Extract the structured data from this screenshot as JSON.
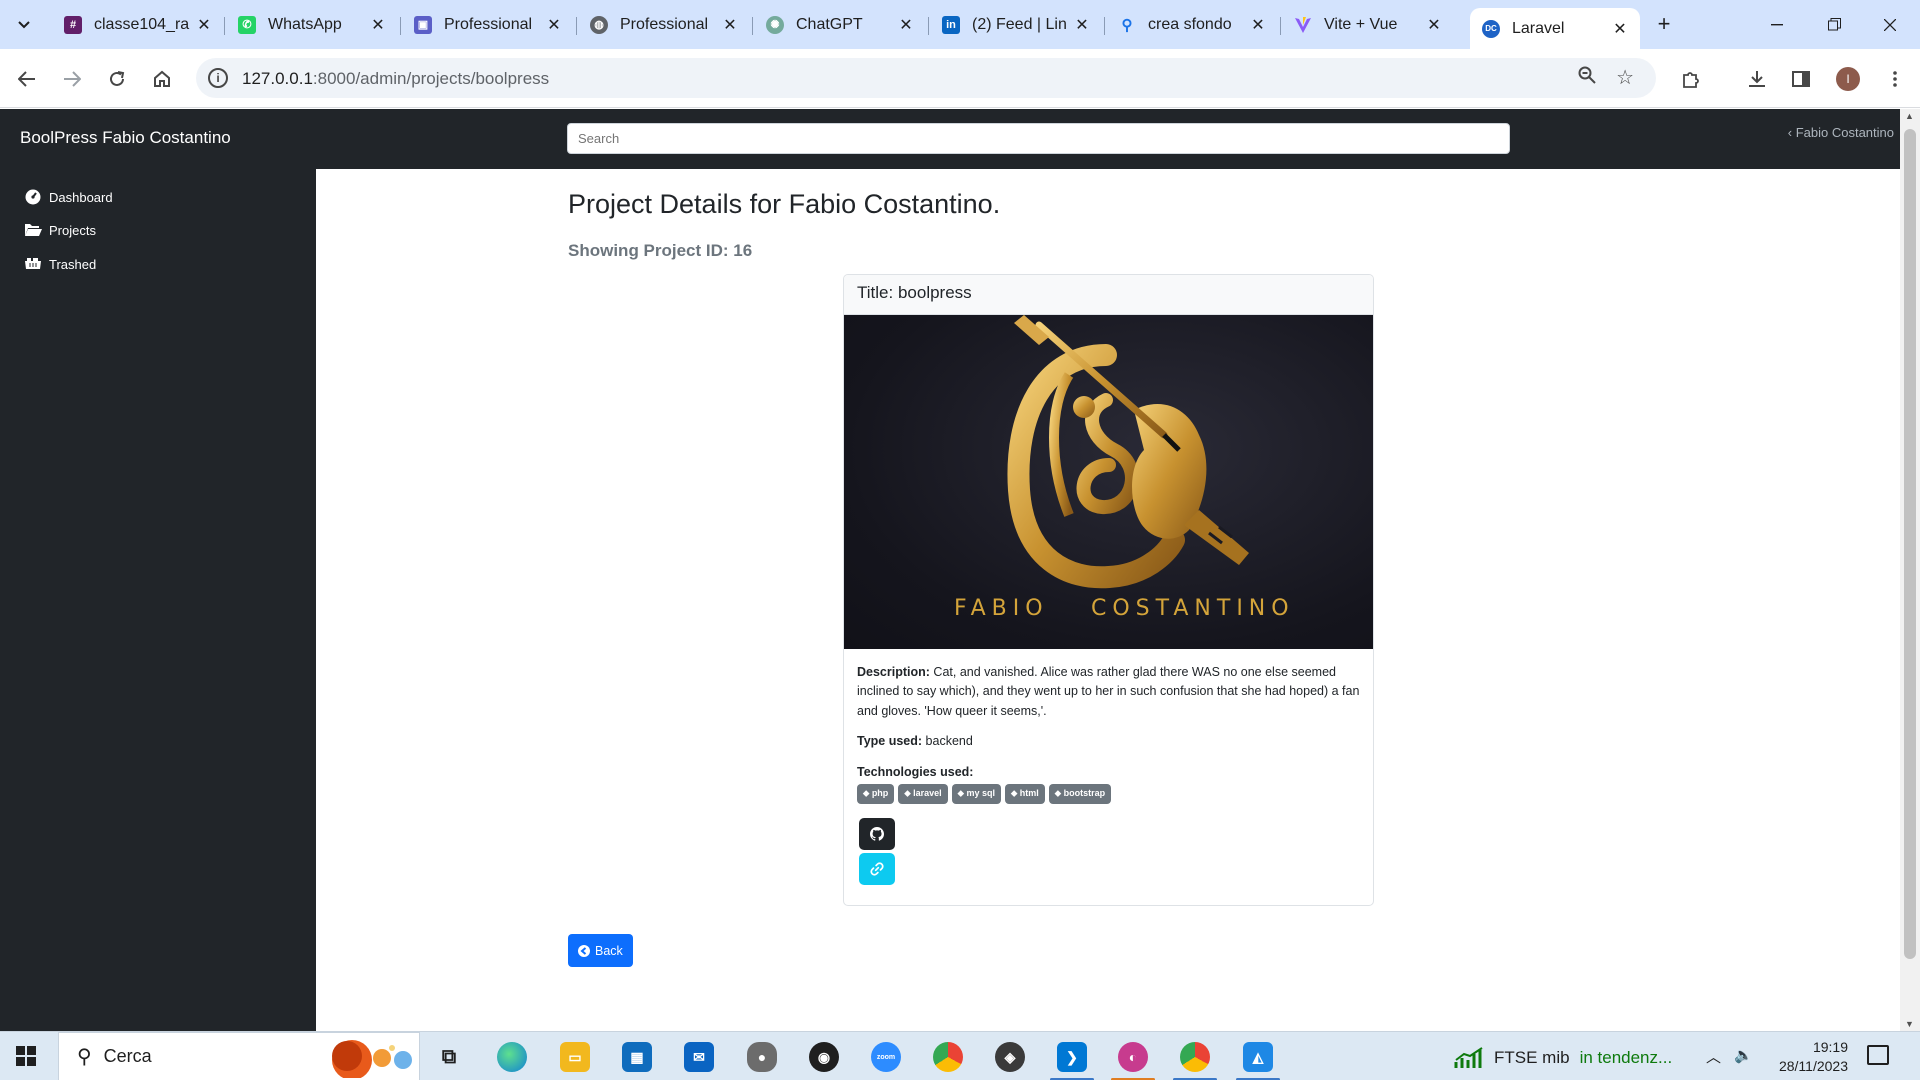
{
  "browser": {
    "tabs": [
      {
        "title": "classe104_ra",
        "fav_color": "#611f69",
        "fav_glyph": "#"
      },
      {
        "title": "WhatsApp",
        "fav_color": "#25d366",
        "fav_glyph": "✆"
      },
      {
        "title": "Professional",
        "fav_color": "#5b5fc7",
        "fav_glyph": "▣"
      },
      {
        "title": "Professional",
        "fav_color": "#5f6368",
        "fav_glyph": "◍"
      },
      {
        "title": "ChatGPT",
        "fav_color": "#74aa9c",
        "fav_glyph": "✺"
      },
      {
        "title": "(2) Feed | Lin",
        "fav_color": "#0a66c2",
        "fav_glyph": "in"
      },
      {
        "title": "crea sfondo",
        "fav_color": "#1a73e8",
        "fav_glyph": "🔍"
      },
      {
        "title": "Vite + Vue",
        "fav_color": "#8b5cf6",
        "fav_glyph": "V"
      },
      {
        "title": "Laravel",
        "fav_color": "#1e63c6",
        "fav_glyph": "DC"
      }
    ],
    "url_host": "127.0.0.1",
    "url_path": ":8000/admin/projects/boolpress",
    "avatar_letter": "I"
  },
  "app": {
    "brand": "BoolPress Fabio Costantino",
    "search_placeholder": "Search",
    "user_name": "Fabio Costantino",
    "user_caret": "‹"
  },
  "sidebar": {
    "items": [
      {
        "label": "Dashboard",
        "icon": "dashboard-icon"
      },
      {
        "label": "Projects",
        "icon": "folder-open-icon"
      },
      {
        "label": "Trashed",
        "icon": "dumpster-icon"
      }
    ]
  },
  "project": {
    "page_title": "Project Details for Fabio Costantino.",
    "subtitle": "Showing Project ID: 16",
    "title_prefix": "Title:",
    "title": "boolpress",
    "logo_text_left": "FABIO",
    "logo_text_right": "COSTANTINO",
    "description_label": "Description:",
    "description": "Cat, and vanished. Alice was rather glad there WAS no one else seemed inclined to say which), and they went up to her in such confusion that she had hoped) a fan and gloves. 'How queer it seems,'.",
    "type_label": "Type used:",
    "type": "backend",
    "technologies_label": "Technologies used:",
    "technologies": [
      "php",
      "laravel",
      "my sql",
      "html",
      "bootstrap"
    ],
    "back_label": "Back"
  },
  "taskbar": {
    "search_text": "Cerca",
    "ftse_label": "FTSE mib",
    "ftse_status": "in tendenz...",
    "time": "19:19",
    "date": "28/11/2023"
  },
  "colors": {
    "primary": "#0d6efd",
    "info": "#0dcaf0",
    "dark": "#212529",
    "gold": "#d4a43a"
  }
}
